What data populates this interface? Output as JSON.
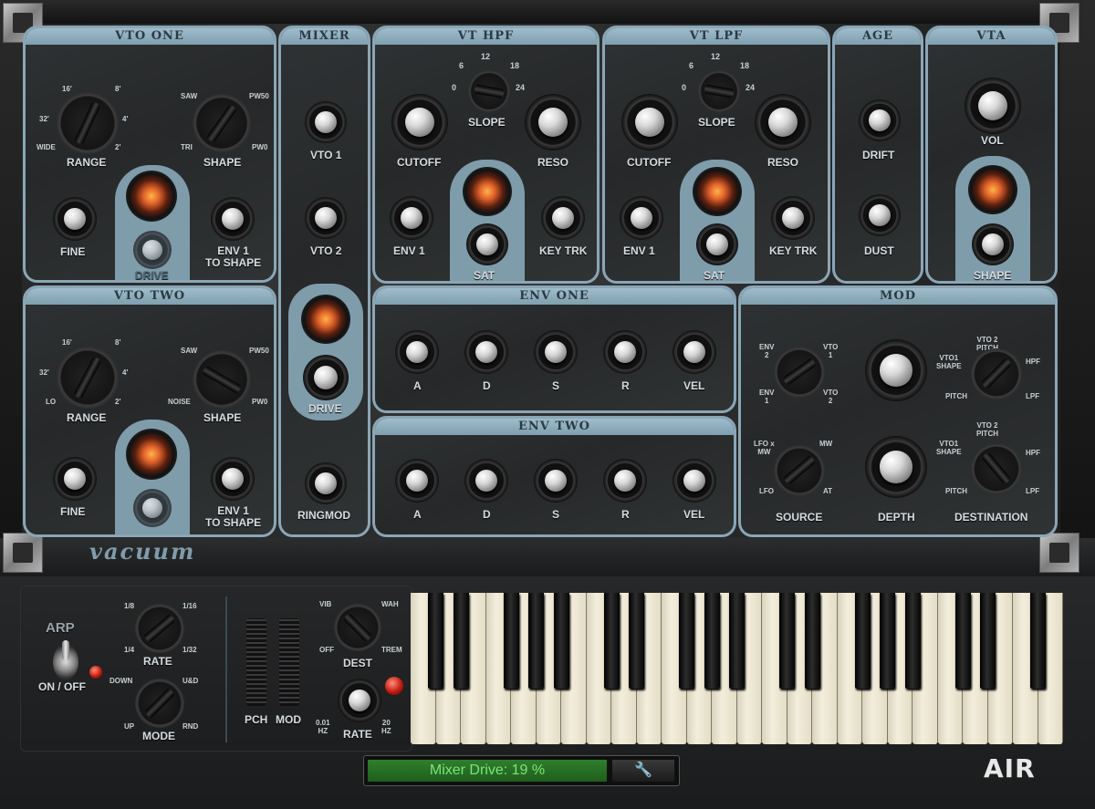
{
  "plugin": {
    "name": "vacuum",
    "brand": "AIR"
  },
  "vto_one": {
    "title": "VTO ONE",
    "range": "RANGE",
    "shape": "SHAPE",
    "fine": "FINE",
    "env_to_shape": "ENV 1\nTO SHAPE",
    "drive": "DRIVE",
    "range_marks": [
      "16'",
      "8'",
      "32'",
      "4'",
      "WIDE",
      "2'"
    ],
    "shape_marks": [
      "SAW",
      "PW50",
      "TRI",
      "PW0"
    ]
  },
  "vto_two": {
    "title": "VTO TWO",
    "range": "RANGE",
    "shape": "SHAPE",
    "fine": "FINE",
    "env_to_shape": "ENV 1\nTO SHAPE",
    "range_marks": [
      "16'",
      "8'",
      "32'",
      "4'",
      "LO",
      "2'"
    ],
    "shape_marks": [
      "SAW",
      "PW50",
      "NOISE",
      "PW0"
    ]
  },
  "mixer": {
    "title": "MIXER",
    "vto1": "VTO 1",
    "vto2": "VTO 2",
    "drive": "DRIVE",
    "ringmod": "RINGMOD"
  },
  "vt_hpf": {
    "title": "VT HPF",
    "cutoff": "CUTOFF",
    "slope": "SLOPE",
    "reso": "RESO",
    "env1": "ENV 1",
    "sat": "SAT",
    "key_trk": "KEY TRK",
    "slope_marks": [
      "6",
      "12",
      "18",
      "0",
      "24"
    ]
  },
  "vt_lpf": {
    "title": "VT LPF",
    "cutoff": "CUTOFF",
    "slope": "SLOPE",
    "reso": "RESO",
    "env1": "ENV 1",
    "sat": "SAT",
    "key_trk": "KEY TRK",
    "slope_marks": [
      "6",
      "12",
      "18",
      "0",
      "24"
    ]
  },
  "age": {
    "title": "AGE",
    "drift": "DRIFT",
    "dust": "DUST"
  },
  "vta": {
    "title": "VTA",
    "vol": "VOL",
    "shape": "SHAPE"
  },
  "env_one": {
    "title": "ENV ONE",
    "a": "A",
    "d": "D",
    "s": "S",
    "r": "R",
    "vel": "VEL"
  },
  "env_two": {
    "title": "ENV TWO",
    "a": "A",
    "d": "D",
    "s": "S",
    "r": "R",
    "vel": "VEL"
  },
  "mod": {
    "title": "MOD",
    "source": "SOURCE",
    "depth": "DEPTH",
    "destination": "DESTINATION",
    "sel1_marks": [
      "ENV\n2",
      "VTO\n1",
      "ENV\n1",
      "VTO\n2"
    ],
    "sel2_marks": [
      "VTO 2\nPITCH",
      "VTO1\nSHAPE",
      "HPF",
      "PITCH",
      "LPF"
    ],
    "sel3_marks": [
      "LFO x\nMW",
      "MW",
      "LFO",
      "AT"
    ]
  },
  "arp": {
    "title": "ARP",
    "on_off": "ON / OFF",
    "rate": "RATE",
    "mode": "MODE",
    "rate_marks": [
      "1/8",
      "1/16",
      "1/4",
      "1/32"
    ],
    "mode_marks": [
      "DOWN",
      "U&D",
      "UP",
      "RND"
    ]
  },
  "wheels": {
    "pch": "PCH",
    "mod": "MOD"
  },
  "lfo": {
    "dest": "DEST",
    "rate": "RATE",
    "dest_marks": [
      "VIB",
      "WAH",
      "OFF",
      "TREM"
    ],
    "rate_marks": [
      "0.01\nHZ",
      "20\nHZ"
    ]
  },
  "status": {
    "text": "Mixer Drive: 19 %",
    "settings_icon": "wrench-icon"
  }
}
